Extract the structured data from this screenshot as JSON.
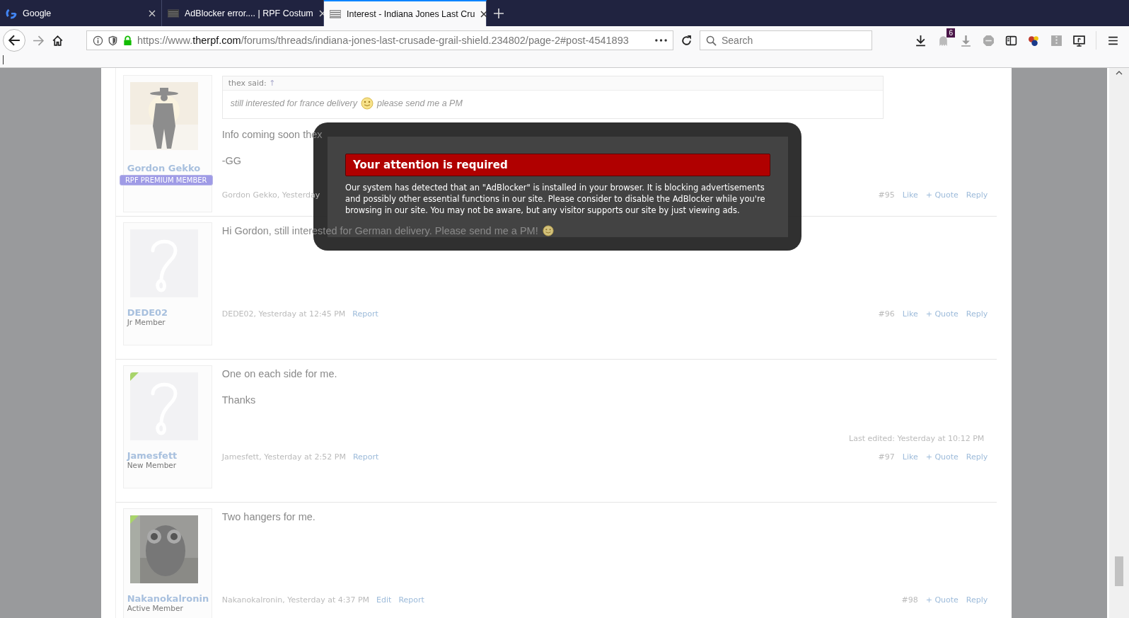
{
  "browser": {
    "tabs": [
      {
        "title": "Google",
        "kind": "google",
        "selected": false
      },
      {
        "title": "AdBlocker error.... | RPF Costum",
        "kind": "site",
        "selected": false
      },
      {
        "title": "Interest - Indiana Jones Last Cru",
        "kind": "site",
        "selected": true
      }
    ],
    "url": {
      "scheme": "https://www.",
      "domain": "therpf.com",
      "path": "/forums/threads/indiana-jones-last-crusade-grail-shield.234802/page-2#post-4541893"
    },
    "search": {
      "placeholder": "Search"
    },
    "notification_badge": "6"
  },
  "posts": [
    {
      "author": "Gordon Gekko",
      "role": {
        "text": "RPF PREMIUM MEMBER",
        "kind": "badge"
      },
      "avatar": {
        "kind": "picture"
      },
      "ribbon": false,
      "quote": {
        "author": "thex said:",
        "jump": "↑",
        "parts": [
          {
            "kind": "text",
            "text": "still interested for france delivery"
          },
          {
            "kind": "smiley"
          },
          {
            "kind": "text",
            "text": "please send me a PM"
          }
        ]
      },
      "paragraphs": [
        {
          "text": "Info coming soon thex",
          "smiley": false
        },
        {
          "text": "-GG",
          "smiley": false
        }
      ],
      "meta": "Gordon Gekko, Yesterday",
      "number": "#95",
      "actions": [
        "Like",
        "+ Quote",
        "Reply"
      ]
    },
    {
      "author": "DEDE02",
      "role": {
        "text": "Jr Member",
        "kind": "title"
      },
      "avatar": {
        "kind": "default"
      },
      "ribbon": false,
      "paragraphs": [
        {
          "text": "Hi Gordon, still interested for German delivery. Please send me a PM!",
          "smiley": true
        }
      ],
      "meta": "DEDE02, Yesterday at 12:45 PM",
      "links": [
        "Report"
      ],
      "number": "#96",
      "actions": [
        "Like",
        "+ Quote",
        "Reply"
      ]
    },
    {
      "author": "Jamesfett",
      "role": {
        "text": "New Member",
        "kind": "title"
      },
      "avatar": {
        "kind": "default"
      },
      "ribbon": true,
      "paragraphs": [
        {
          "text": "One on each side for me.",
          "smiley": false
        },
        {
          "text": "Thanks",
          "smiley": false
        }
      ],
      "meta": "Jamesfett, Yesterday at 2:52 PM",
      "links": [
        "Report"
      ],
      "edited": "Last edited: Yesterday at 10:12 PM",
      "number": "#97",
      "actions": [
        "Like",
        "+ Quote",
        "Reply"
      ]
    },
    {
      "author": "Nakanokalronin",
      "role": {
        "text": "Active Member",
        "kind": "title"
      },
      "avatar": {
        "kind": "picture"
      },
      "ribbon": true,
      "paragraphs": [
        {
          "text": "Two hangers for me.",
          "smiley": false
        }
      ],
      "meta": "Nakanokalronin, Yesterday at 4:37 PM",
      "links": [
        "Edit",
        "Report"
      ],
      "number": "#98",
      "actions": [
        "+ Quote",
        "Reply"
      ]
    }
  ],
  "dialog": {
    "title": "Your attention is required",
    "body": "Our system has detected that an \"AdBlocker\" is installed in your browser. It is blocking advertisements and possibly other essential functions in our site. Please consider to disable the AdBlocker while you're browsing in our site. You may not be aware, but any visitor supports our site by just viewing ads."
  }
}
